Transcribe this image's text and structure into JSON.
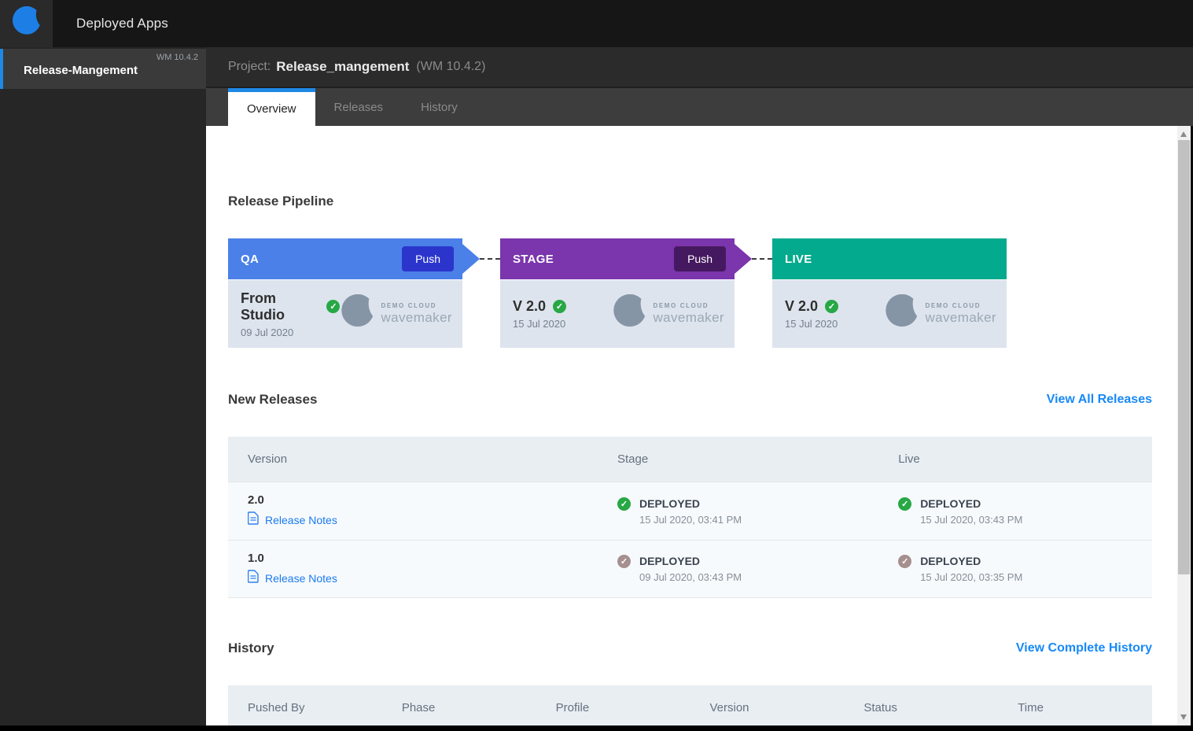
{
  "topbar": {
    "app_title": "Deployed Apps"
  },
  "sidebar": {
    "active_item": {
      "label": "Release-Mangement",
      "version": "WM 10.4.2"
    }
  },
  "project_bar": {
    "prefix": "Project:",
    "name": "Release_mangement",
    "version": "(WM 10.4.2)"
  },
  "tabs": [
    {
      "label": "Overview",
      "active": true
    },
    {
      "label": "Releases",
      "active": false
    },
    {
      "label": "History",
      "active": false
    }
  ],
  "pipeline": {
    "heading": "Release Pipeline",
    "logo": {
      "line1": "DEMO CLOUD",
      "line2": "wavemaker"
    },
    "stages": [
      {
        "name": "QA",
        "push_label": "Push",
        "version_label": "From Studio",
        "date": "09 Jul 2020",
        "header_color": "#4a80e8",
        "push_color": "#2b35cc",
        "check": "green"
      },
      {
        "name": "STAGE",
        "push_label": "Push",
        "version_label": "V 2.0",
        "date": "15 Jul 2020",
        "header_color": "#7b35ad",
        "push_color": "#45195f",
        "check": "green"
      },
      {
        "name": "LIVE",
        "version_label": "V 2.0",
        "date": "15 Jul 2020",
        "header_color": "#04aa8d",
        "check": "green"
      }
    ]
  },
  "new_releases": {
    "heading": "New Releases",
    "view_all_label": "View All Releases",
    "columns": [
      "Version",
      "Stage",
      "Live"
    ],
    "rows": [
      {
        "version": "2.0",
        "notes_label": "Release Notes",
        "stage": {
          "status": "DEPLOYED",
          "time": "15 Jul 2020, 03:41 PM",
          "check": "green"
        },
        "live": {
          "status": "DEPLOYED",
          "time": "15 Jul 2020, 03:43 PM",
          "check": "green"
        }
      },
      {
        "version": "1.0",
        "notes_label": "Release Notes",
        "stage": {
          "status": "DEPLOYED",
          "time": "09 Jul 2020, 03:43 PM",
          "check": "muted"
        },
        "live": {
          "status": "DEPLOYED",
          "time": "15 Jul 2020, 03:35 PM",
          "check": "muted"
        }
      }
    ]
  },
  "history": {
    "heading": "History",
    "view_all_label": "View Complete History",
    "columns": [
      "Pushed By",
      "Phase",
      "Profile",
      "Version",
      "Status",
      "Time"
    ]
  },
  "colors": {
    "accent_blue": "#1e88e5",
    "link_blue": "#1789f8",
    "qa_header": "#4a80e8",
    "qa_push": "#2b35cc",
    "stage_header": "#7b35ad",
    "stage_push": "#45195f",
    "live_header": "#04aa8d",
    "card_body": "#dde4ee",
    "green_check": "#27a845",
    "muted_check": "#a58f8f",
    "table_header_bg": "#e9eef3",
    "row_bg": "#f7fafc"
  }
}
